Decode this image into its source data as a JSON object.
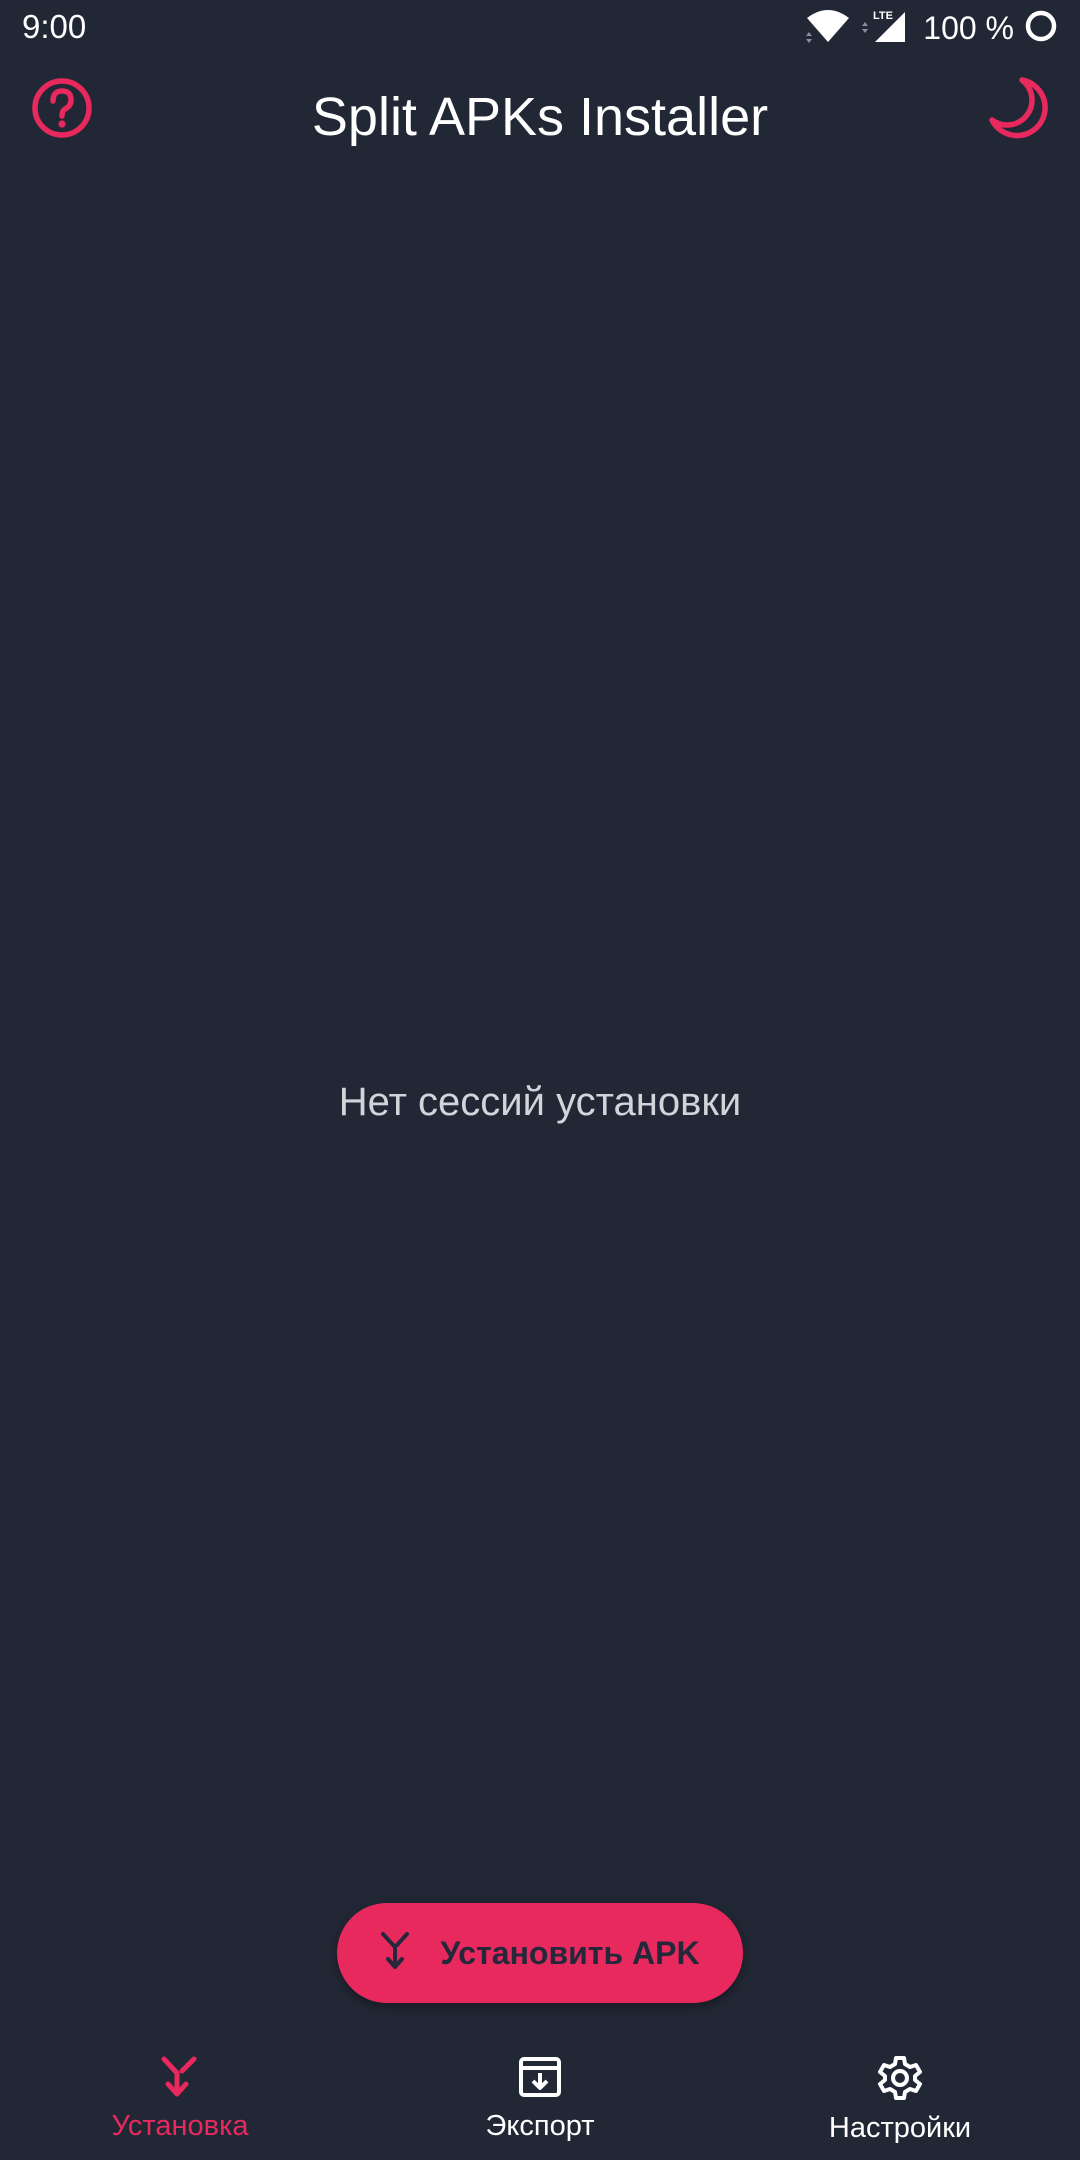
{
  "status_bar": {
    "time": "9:00",
    "network_badge": "LTE",
    "battery": "100 %"
  },
  "app_bar": {
    "title": "Split APKs Installer",
    "help_icon": "help-circle-icon",
    "theme_icon": "moon-icon"
  },
  "main": {
    "empty_message": "Нет сессий установки"
  },
  "fab": {
    "label": "Установить APK",
    "icon": "install-arrow-icon"
  },
  "bottom_nav": {
    "items": [
      {
        "label": "Установка",
        "icon": "install-arrow-icon",
        "active": true
      },
      {
        "label": "Экспорт",
        "icon": "archive-download-icon",
        "active": false
      },
      {
        "label": "Настройки",
        "icon": "gear-icon",
        "active": false
      }
    ]
  },
  "colors": {
    "background": "#222735",
    "accent": "#e8295d",
    "text": "#ffffff",
    "muted_text": "#d2d4da"
  }
}
